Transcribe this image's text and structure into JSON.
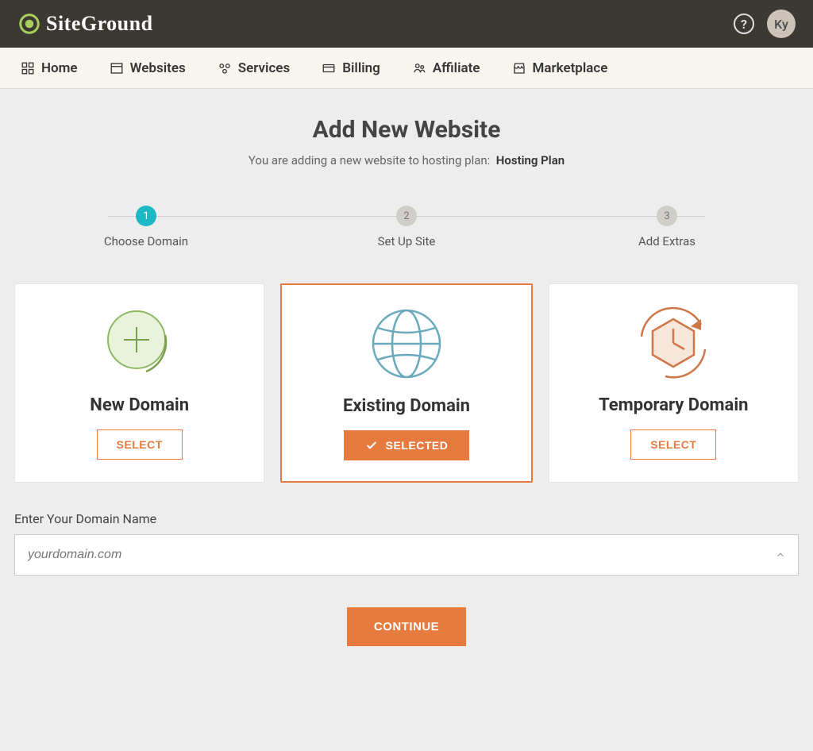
{
  "brand": {
    "name": "SiteGround"
  },
  "user": {
    "initials": "Ky"
  },
  "nav": [
    {
      "label": "Home"
    },
    {
      "label": "Websites"
    },
    {
      "label": "Services"
    },
    {
      "label": "Billing"
    },
    {
      "label": "Affiliate"
    },
    {
      "label": "Marketplace"
    }
  ],
  "page": {
    "title": "Add New Website",
    "subtitle_prefix": "You are adding a new website to hosting plan:",
    "plan_name": "Hosting Plan"
  },
  "steps": [
    {
      "num": "1",
      "label": "Choose Domain",
      "active": true
    },
    {
      "num": "2",
      "label": "Set Up Site",
      "active": false
    },
    {
      "num": "3",
      "label": "Add Extras",
      "active": false
    }
  ],
  "cards": [
    {
      "title": "New Domain",
      "button": "SELECT",
      "selected": false
    },
    {
      "title": "Existing Domain",
      "button": "SELECTED",
      "selected": true
    },
    {
      "title": "Temporary Domain",
      "button": "SELECT",
      "selected": false
    }
  ],
  "domain_field": {
    "label": "Enter Your Domain Name",
    "placeholder": "yourdomain.com"
  },
  "continue_label": "CONTINUE"
}
